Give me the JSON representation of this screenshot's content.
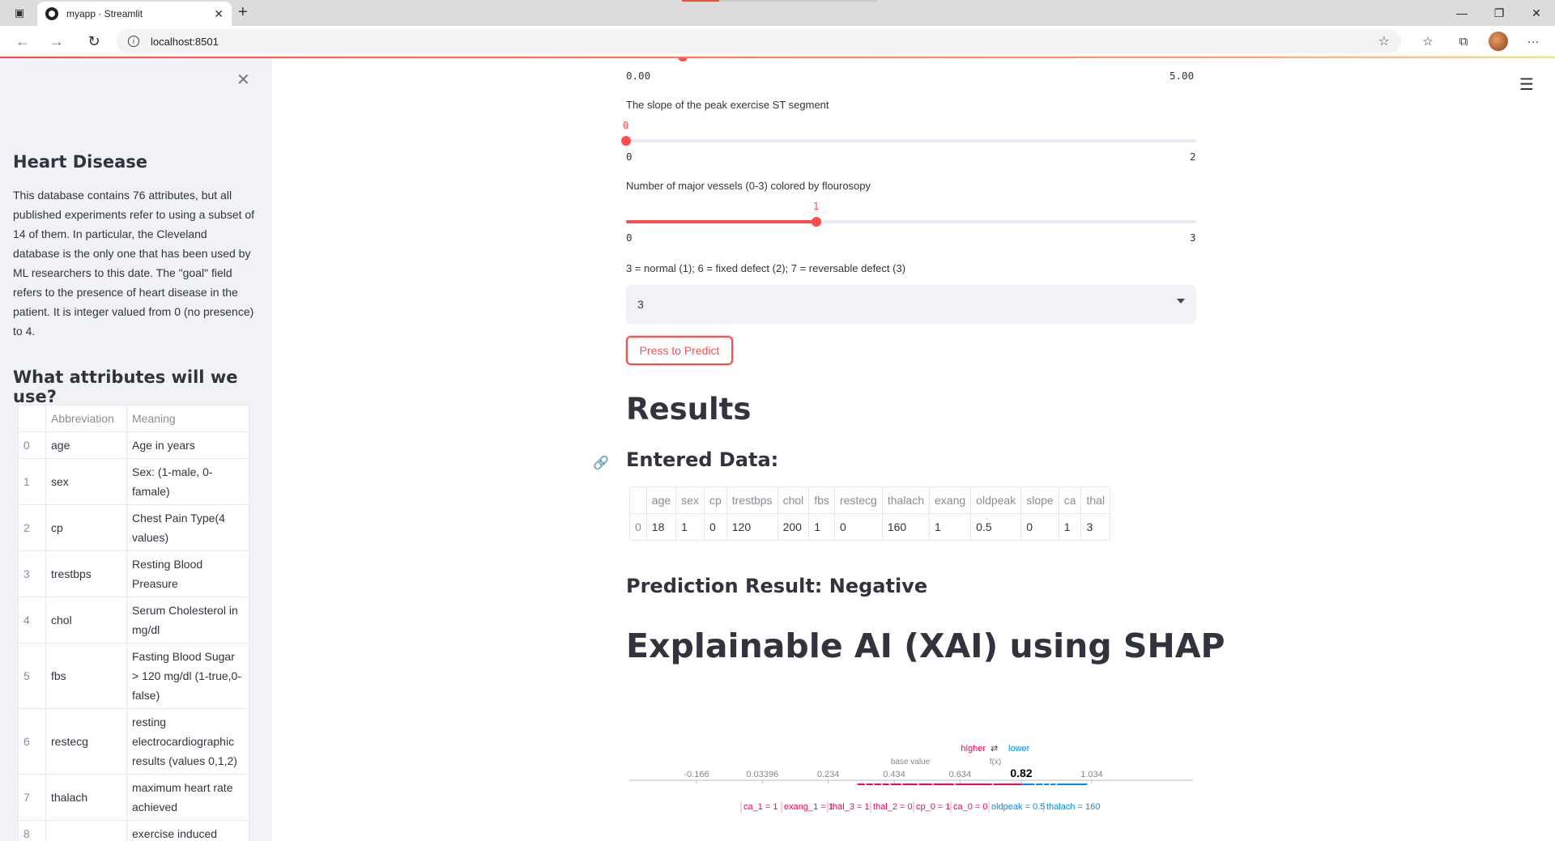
{
  "browser": {
    "tab_title": "myapp · Streamlit",
    "url": "localhost:8501"
  },
  "sidebar": {
    "heading": "Heart Disease",
    "description": "This database contains 76 attributes, but all published experiments refer to using a subset of 14 of them. In particular, the Cleveland database is the only one that has been used by ML researchers to this date. The \"goal\" field refers to the presence of heart disease in the patient. It is integer valued from 0 (no presence) to 4.",
    "attributes_heading": "What attributes will we use?",
    "table_headers": [
      "",
      "Abbreviation",
      "Meaning"
    ],
    "table_rows": [
      {
        "idx": "0",
        "abbr": "age",
        "meaning": "Age in years"
      },
      {
        "idx": "1",
        "abbr": "sex",
        "meaning": "Sex: (1-male, 0-famale)"
      },
      {
        "idx": "2",
        "abbr": "cp",
        "meaning": "Chest Pain Type(4 values)"
      },
      {
        "idx": "3",
        "abbr": "trestbps",
        "meaning": "Resting Blood Preasure"
      },
      {
        "idx": "4",
        "abbr": "chol",
        "meaning": "Serum Cholesterol in mg/dl"
      },
      {
        "idx": "5",
        "abbr": "fbs",
        "meaning": "Fasting Blood Sugar > 120 mg/dl (1-true,0-false)"
      },
      {
        "idx": "6",
        "abbr": "restecg",
        "meaning": "resting electrocardiographic results (values 0,1,2)"
      },
      {
        "idx": "7",
        "abbr": "thalach",
        "meaning": "maximum heart rate achieved"
      },
      {
        "idx": "8",
        "abbr": "",
        "meaning": "exercise induced"
      }
    ]
  },
  "main": {
    "oldpeak_slider": {
      "min": "0.00",
      "max": "5.00"
    },
    "slope_slider": {
      "label": "The slope of the peak exercise ST segment",
      "value": "0",
      "min": "0",
      "max": "2",
      "fraction": 0
    },
    "ca_slider": {
      "label": "Number of major vessels (0-3) colored by flourosopy",
      "value": "1",
      "min": "0",
      "max": "3",
      "fraction": 0.3333
    },
    "thal_select": {
      "label": "3 = normal (1); 6 = fixed defect (2); 7 = reversable defect (3)",
      "value": "3"
    },
    "predict_button": "Press to Predict",
    "results_heading": "Results",
    "entered_heading": "Entered Data:",
    "data_table": {
      "headers": [
        "",
        "age",
        "sex",
        "cp",
        "trestbps",
        "chol",
        "fbs",
        "restecg",
        "thalach",
        "exang",
        "oldpeak",
        "slope",
        "ca",
        "thal"
      ],
      "row": [
        "0",
        "18",
        "1",
        "0",
        "120",
        "200",
        "1",
        "0",
        "160",
        "1",
        "0.5",
        "0",
        "1",
        "3"
      ]
    },
    "prediction_heading": "Prediction Result: Negative",
    "xai_heading": "Explainable AI (XAI) using SHAP",
    "shap": {
      "legend_higher": "higher",
      "legend_lower": "lower",
      "base_value_label": "base value",
      "fx_label": "f(x)",
      "fx_value": "0.82",
      "ticks": [
        "-0.166",
        "0.03396",
        "0.234",
        "0.434",
        "0.634",
        "0.82",
        "1.034"
      ],
      "base_value": 0.434,
      "fx": 0.82,
      "positive_features": [
        "ca_1 = 1",
        "exang_1 = 1",
        "thal_3 = 1",
        "thal_2 = 0",
        "cp_0 = 1",
        "ca_0 = 0"
      ],
      "negative_features": [
        "oldpeak = 0.5",
        "thalach = 160"
      ],
      "colors": {
        "positive": "#ff0051",
        "negative": "#008bfb"
      }
    }
  }
}
